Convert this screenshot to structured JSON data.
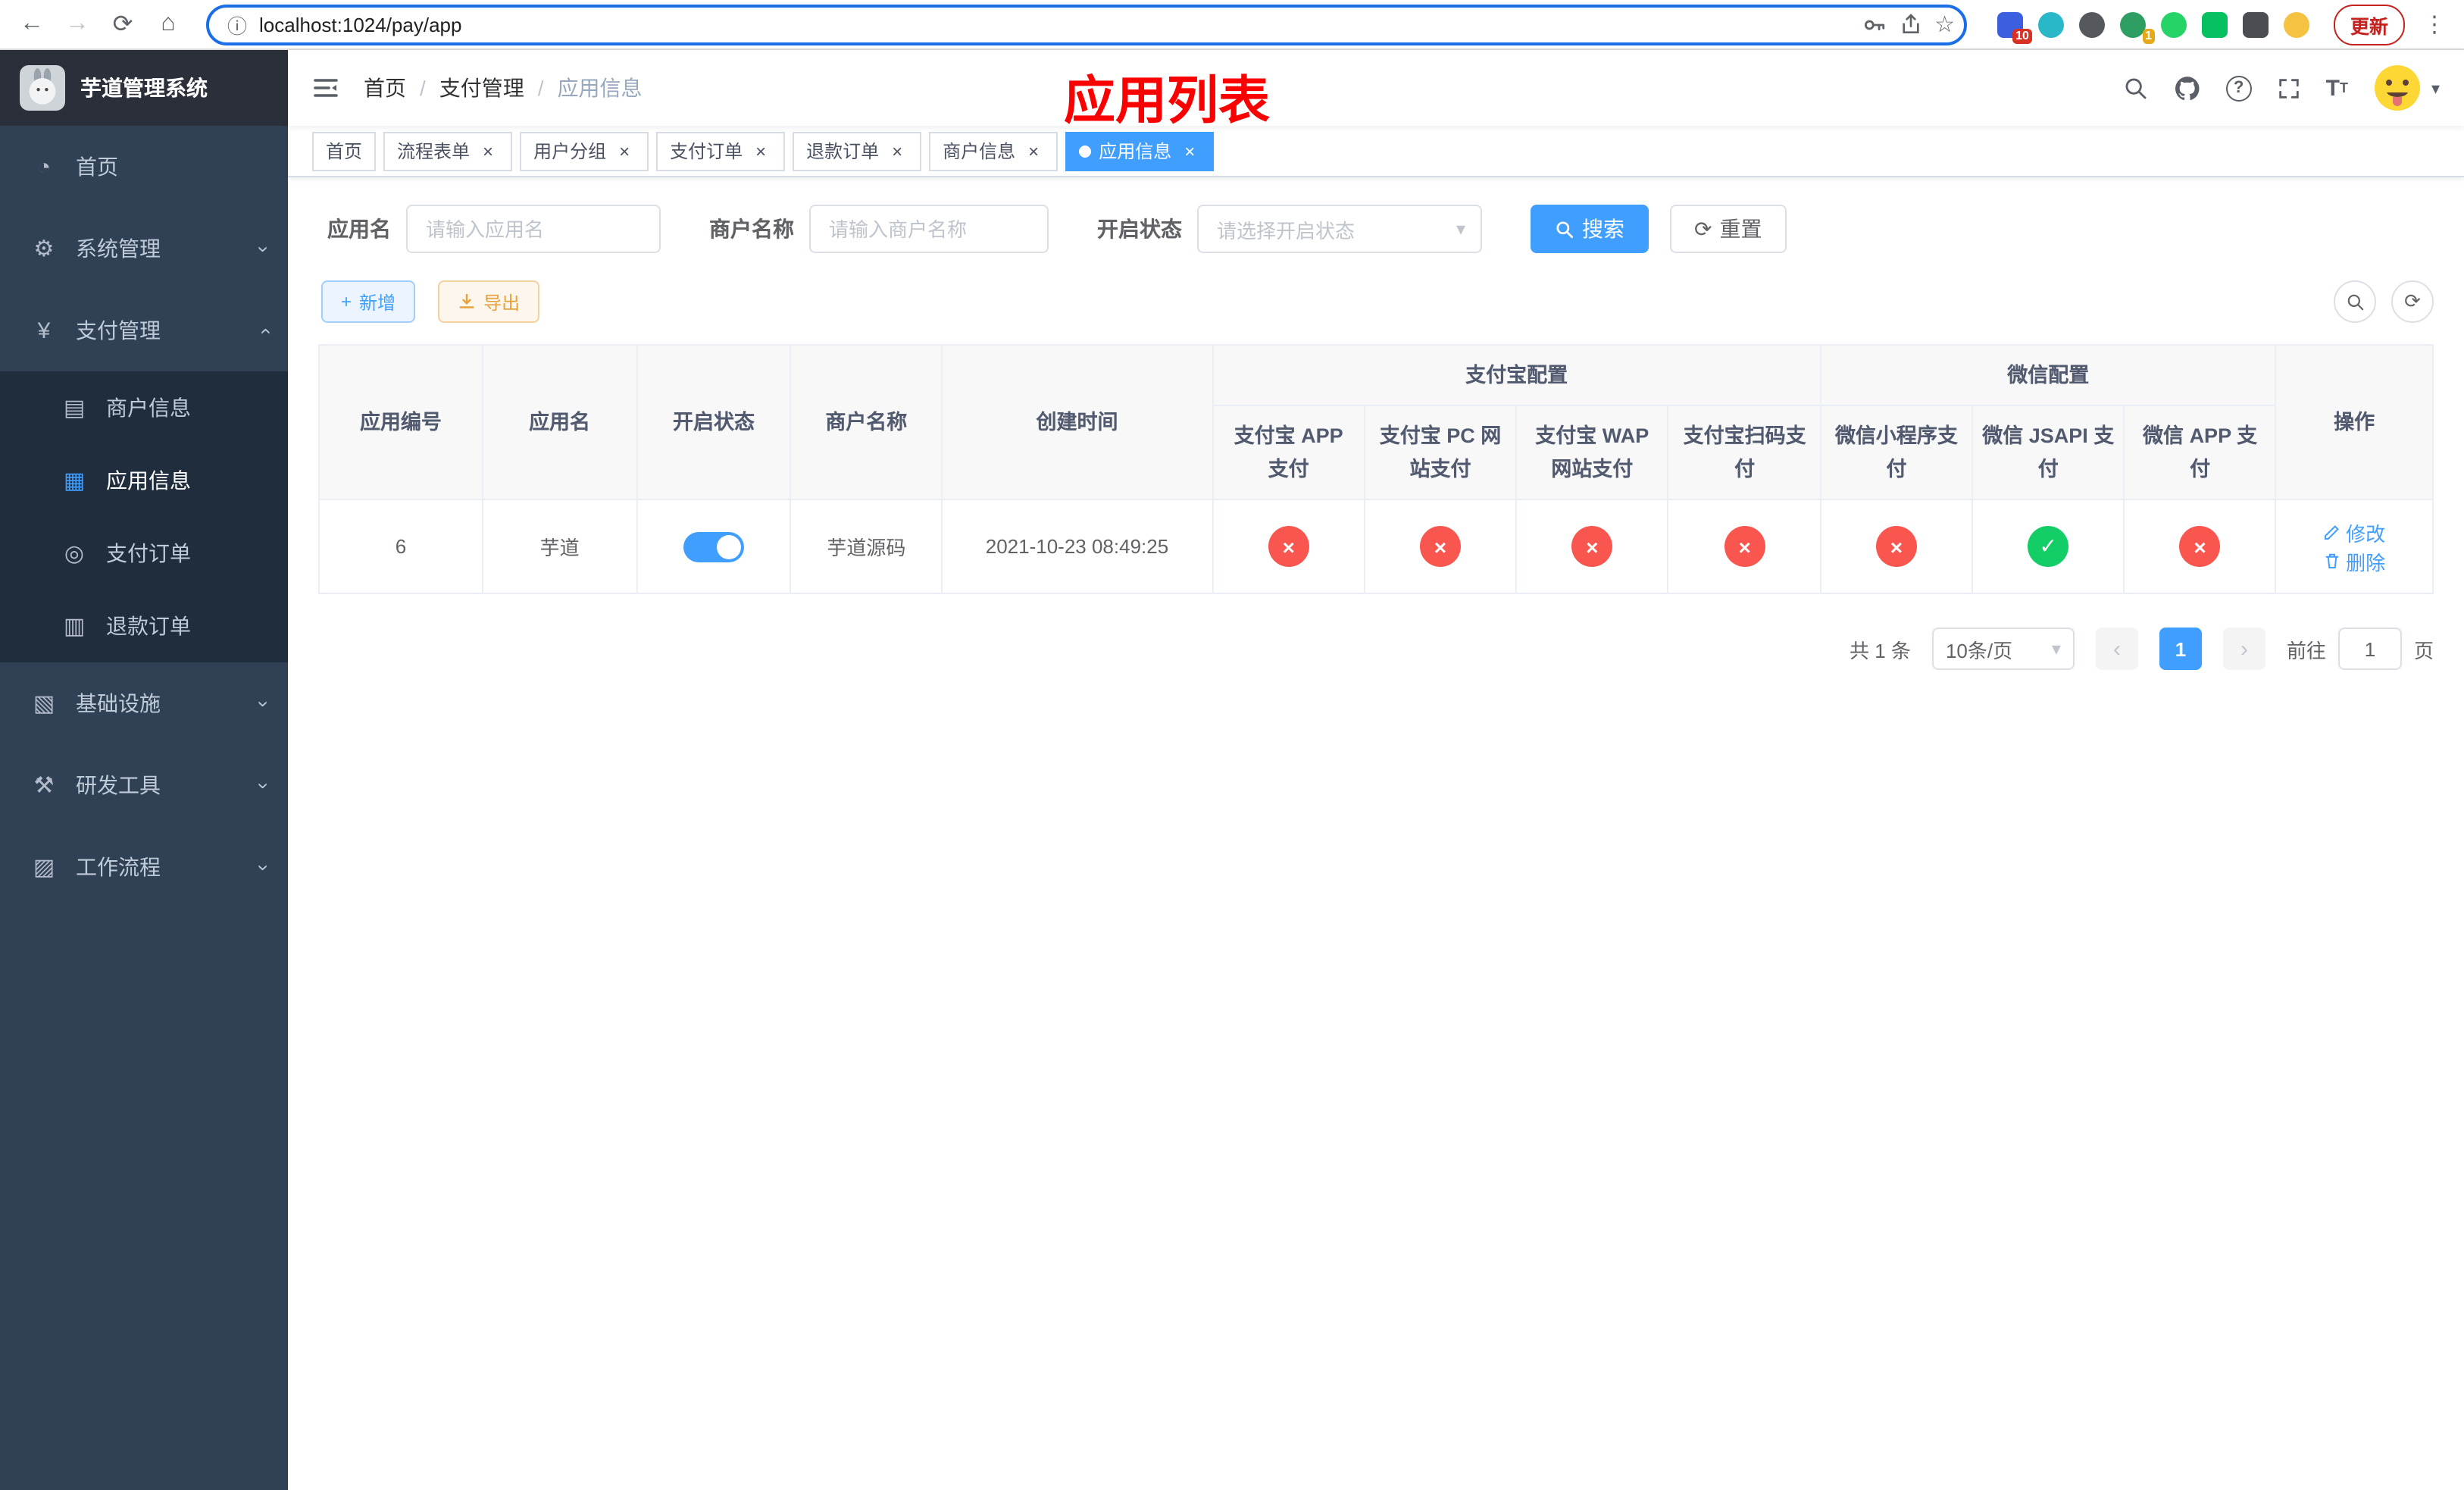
{
  "colors": {
    "accent_blue": "#409eff",
    "success_green": "#13ce66",
    "danger_red": "#f9564f",
    "warning_orange": "#e6a23c",
    "sidebar_bg": "#304156",
    "submenu_bg": "#1f2d3d",
    "annotation_red": "#fb0000",
    "update_red": "#c5221f"
  },
  "icons": {
    "back": "←",
    "forward": "→",
    "reload": "⟳",
    "home": "⌂",
    "info": "ⓘ",
    "star": "☆",
    "menu_dots": "⋮",
    "caret_down": "▾",
    "chevron": "›",
    "close": "×",
    "check": "✓",
    "cross": "×",
    "question": "?",
    "plus": "+",
    "refresh": "⟳",
    "prev": "‹",
    "next": "›",
    "breadcrumb_sep": "/",
    "text_size_big": "T",
    "text_size_small": "T"
  },
  "menu_icons": {
    "dashboard": "◔",
    "system": "⚙",
    "pay": "¥",
    "merchant": "▤",
    "app": "▦",
    "order": "◎",
    "refund": "▥",
    "infra": "▧",
    "devtool": "⚒",
    "workflow": "▨"
  },
  "browser": {
    "url": "localhost:1024/pay/app",
    "update_label": "更新",
    "extension_badges": [
      "10",
      "1"
    ]
  },
  "sidebar": {
    "title": "芋道管理系统",
    "items": [
      {
        "label": "首页"
      },
      {
        "label": "系统管理",
        "expandable": true
      },
      {
        "label": "支付管理",
        "expandable": true,
        "expanded": true,
        "children": [
          {
            "label": "商户信息"
          },
          {
            "label": "应用信息",
            "active": true
          },
          {
            "label": "支付订单"
          },
          {
            "label": "退款订单"
          }
        ]
      },
      {
        "label": "基础设施",
        "expandable": true
      },
      {
        "label": "研发工具",
        "expandable": true
      },
      {
        "label": "工作流程",
        "expandable": true
      }
    ]
  },
  "header": {
    "breadcrumb": [
      "首页",
      "支付管理",
      "应用信息"
    ],
    "overlay_title": "应用列表"
  },
  "tabs": [
    {
      "label": "首页",
      "closable": false
    },
    {
      "label": "流程表单",
      "closable": true
    },
    {
      "label": "用户分组",
      "closable": true
    },
    {
      "label": "支付订单",
      "closable": true
    },
    {
      "label": "退款订单",
      "closable": true
    },
    {
      "label": "商户信息",
      "closable": true
    },
    {
      "label": "应用信息",
      "closable": true,
      "active": true
    }
  ],
  "filters": {
    "app_name_label": "应用名",
    "app_name_placeholder": "请输入应用名",
    "merchant_label": "商户名称",
    "merchant_placeholder": "请输入商户名称",
    "status_label": "开启状态",
    "status_placeholder": "请选择开启状态",
    "search_label": "搜索",
    "reset_label": "重置"
  },
  "toolbar": {
    "add_label": "新增",
    "export_label": "导出"
  },
  "table": {
    "group_alipay": "支付宝配置",
    "group_wechat": "微信配置",
    "columns": [
      "应用编号",
      "应用名",
      "开启状态",
      "商户名称",
      "创建时间",
      "支付宝 APP 支付",
      "支付宝 PC 网站支付",
      "支付宝 WAP 网站支付",
      "支付宝扫码支付",
      "微信小程序支付",
      "微信 JSAPI 支付",
      "微信 APP 支付",
      "操作"
    ],
    "rows": [
      {
        "id": "6",
        "name": "芋道",
        "enabled": true,
        "merchant": "芋道源码",
        "created": "2021-10-23 08:49:25",
        "configs": [
          false,
          false,
          false,
          false,
          false,
          true,
          false
        ],
        "edit_label": "修改",
        "delete_label": "删除"
      }
    ]
  },
  "pagination": {
    "total": "共 1 条",
    "page_size": "10条/页",
    "current": "1",
    "goto": "前往",
    "unit": "页",
    "goto_value": "1"
  }
}
